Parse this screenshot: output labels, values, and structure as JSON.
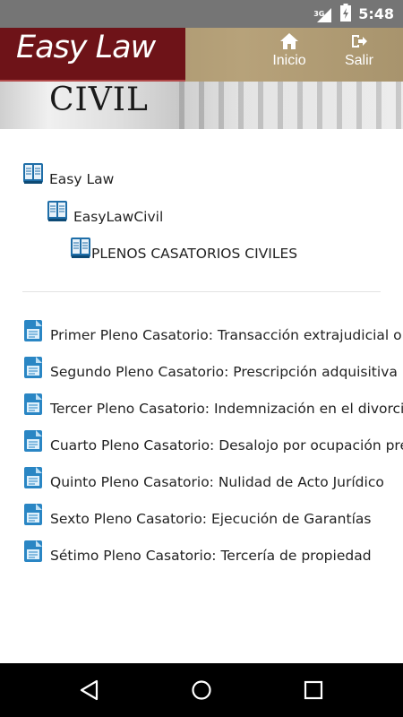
{
  "status_bar": {
    "network": "3G",
    "time": "5:48"
  },
  "header": {
    "brand": "Easy Law",
    "subtitle": "CIVIL",
    "nav": [
      {
        "label": "Inicio",
        "icon": "home-icon"
      },
      {
        "label": "Salir",
        "icon": "exit-icon"
      }
    ]
  },
  "breadcrumb": [
    {
      "label": "Easy Law",
      "icon": "book-icon"
    },
    {
      "label": "EasyLawCivil",
      "icon": "book-icon"
    },
    {
      "label": "PLENOS CASATORIOS CIVILES",
      "icon": "book-icon"
    }
  ],
  "documents": [
    {
      "label": "Primer Pleno Casatorio: Transacción extrajudicial o",
      "icon": "document-icon"
    },
    {
      "label": "Segundo Pleno Casatorio: Prescripción adquisitiva",
      "icon": "document-icon"
    },
    {
      "label": "Tercer Pleno Casatorio: Indemnización en el divorcio",
      "icon": "document-icon"
    },
    {
      "label": "Cuarto Pleno Casatorio: Desalojo por ocupación pre",
      "icon": "document-icon"
    },
    {
      "label": "Quinto Pleno Casatorio: Nulidad de Acto Jurídico",
      "icon": "document-icon"
    },
    {
      "label": "Sexto Pleno Casatorio: Ejecución de Garantías",
      "icon": "document-icon"
    },
    {
      "label": "Sétimo Pleno Casatorio: Tercería de propiedad",
      "icon": "document-icon"
    }
  ],
  "nav_bar": {
    "back": "back-icon",
    "home": "home-circle-icon",
    "recents": "recents-icon"
  },
  "colors": {
    "brand_red": "#6e1318",
    "header_tan": "#a8946d",
    "icon_blue": "#2a86c4"
  }
}
